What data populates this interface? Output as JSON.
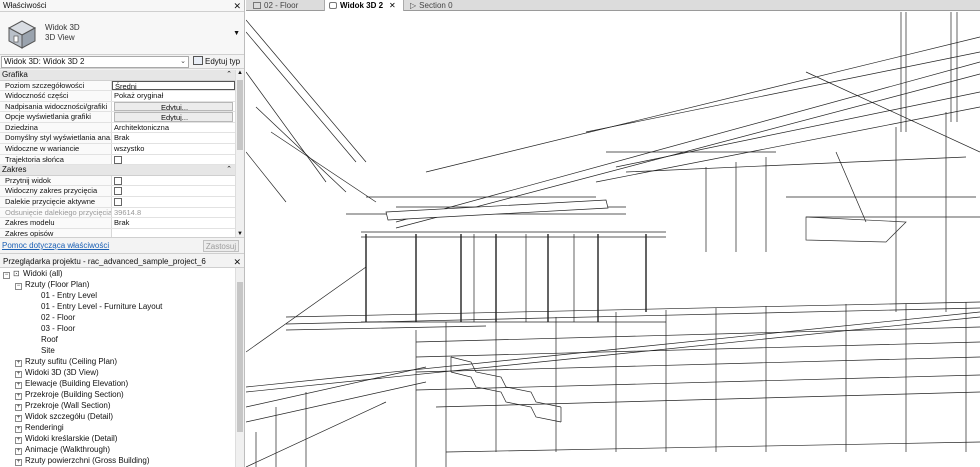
{
  "properties_panel": {
    "title": "Właściwości",
    "type_name": "Widok 3D",
    "type_sub": "3D View",
    "instance_selector": "Widok 3D: Widok 3D 2",
    "edit_type_label": "Edytuj typ",
    "sections": {
      "graphics": "Grafika",
      "extents": "Zakres"
    },
    "rows": [
      {
        "key": "Poziom szczegółowości",
        "value": "Średni"
      },
      {
        "key": "Widoczność części",
        "value": "Pokaż oryginał"
      },
      {
        "key": "Nadpisania widoczności/grafiki",
        "value": "Edytuj..."
      },
      {
        "key": "Opcje wyświetlania grafiki",
        "value": "Edytuj..."
      },
      {
        "key": "Dziedzina",
        "value": "Architektoniczna"
      },
      {
        "key": "Domyślny styl wyświetlania ana...",
        "value": "Brak"
      },
      {
        "key": "Widoczne w wariancie",
        "value": "wszystko"
      },
      {
        "key": "Trajektoria słońca",
        "value": ""
      },
      {
        "key": "Przytnij widok",
        "value": ""
      },
      {
        "key": "Widoczny zakres przycięcia",
        "value": ""
      },
      {
        "key": "Dalekie przycięcie aktywne",
        "value": ""
      },
      {
        "key": "Odsunięcie dalekiego przycięcia",
        "value": "39614.8"
      },
      {
        "key": "Zakres modelu",
        "value": "Brak"
      },
      {
        "key": "Zakres opisów",
        "value": ""
      }
    ],
    "help_link": "Pomoc dotycząca właściwości",
    "apply_label": "Zastosuj"
  },
  "project_browser": {
    "title": "Przeglądarka projektu - rac_advanced_sample_project_6",
    "root": "Widoki (all)",
    "floor_plans": "Rzuty (Floor Plan)",
    "floor_plan_items": [
      "01 - Entry Level",
      "01 - Entry Level - Furniture Layout",
      "02 - Floor",
      "03 - Floor",
      "Roof",
      "Site"
    ],
    "categories": [
      "Rzuty sufitu (Ceiling Plan)",
      "Widoki 3D (3D View)",
      "Elewacje (Building Elevation)",
      "Przekroje (Building Section)",
      "Przekroje (Wall Section)",
      "Widok szczegółu (Detail)",
      "Renderingi",
      "Widoki kreślarskie (Detail)",
      "Animacje (Walkthrough)",
      "Rzuty powierzchni (Gross Building)"
    ]
  },
  "tabs": [
    {
      "label": "02 - Floor",
      "active": false
    },
    {
      "label": "Widok 3D 2",
      "active": true
    },
    {
      "label": "Section 0",
      "active": false
    }
  ],
  "icons": {
    "close": "close-icon",
    "collapse": "chevron-up-icon",
    "tree_expand": "plus-box-icon",
    "tree_collapse": "minus-box-icon"
  }
}
